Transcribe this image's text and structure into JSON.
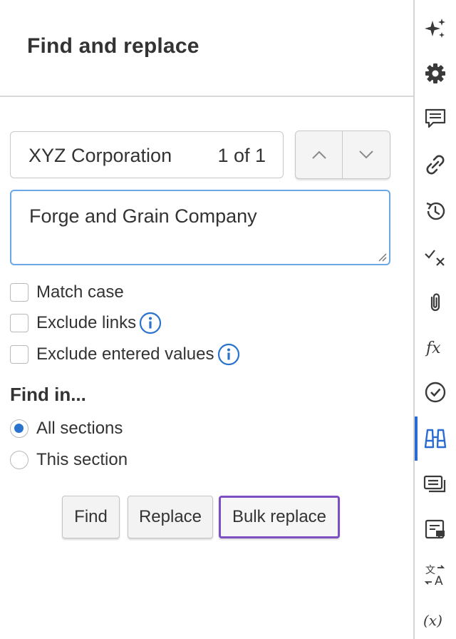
{
  "panel": {
    "title": "Find and replace"
  },
  "find": {
    "value": "XYZ Corporation",
    "match_count": "1 of 1"
  },
  "replace": {
    "value": "Forge and Grain Company"
  },
  "options": [
    {
      "label": "Match case",
      "checked": false,
      "has_info": false
    },
    {
      "label": "Exclude links",
      "checked": false,
      "has_info": true
    },
    {
      "label": "Exclude entered values",
      "checked": false,
      "has_info": true
    }
  ],
  "scope": {
    "heading": "Find in...",
    "options": [
      {
        "label": "All sections",
        "selected": true
      },
      {
        "label": "This section",
        "selected": false
      }
    ]
  },
  "actions": {
    "find_label": "Find",
    "replace_label": "Replace",
    "bulk_replace_label": "Bulk replace"
  },
  "rail": {
    "icons": [
      "sparkle-icon",
      "gear-icon",
      "comment-icon",
      "link-icon",
      "history-icon",
      "check-x-icon",
      "paperclip-icon",
      "function-icon",
      "check-circle-icon",
      "binoculars-icon",
      "cards-icon",
      "note-icon",
      "translate-icon",
      "variable-icon"
    ],
    "active": "binoculars-icon",
    "function_glyph": "fx",
    "translate_glyphs": [
      "文",
      "A"
    ],
    "variable_glyph": "(x)"
  },
  "colors": {
    "accent_blue": "#2a73cc",
    "focus_border": "#6aa6e8",
    "highlight_purple": "#7d4fc0",
    "active_rail_bar": "#2a6bd1"
  }
}
